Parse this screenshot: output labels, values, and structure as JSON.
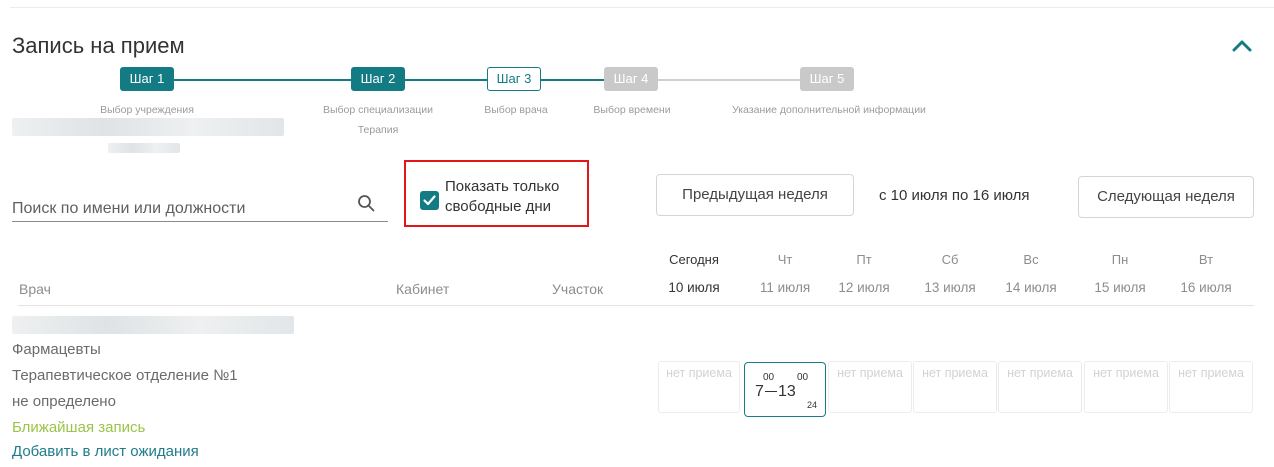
{
  "page_title": "Запись на прием",
  "stepper": {
    "steps": [
      {
        "label": "Шаг 1",
        "caption": "Выбор учреждения",
        "state": "done"
      },
      {
        "label": "Шаг 2",
        "caption": "Выбор специализации",
        "sub": "Терапия",
        "state": "done"
      },
      {
        "label": "Шаг 3",
        "caption": "Выбор врача",
        "state": "current"
      },
      {
        "label": "Шаг 4",
        "caption": "Выбор времени",
        "state": "todo"
      },
      {
        "label": "Шаг 5",
        "caption": "Указание дополнительной информации",
        "state": "todo"
      }
    ]
  },
  "search": {
    "placeholder": "Поиск по имени или должности",
    "value": ""
  },
  "filter": {
    "label_line1": "Показать только",
    "label_line2": "свободные дни",
    "checked": true
  },
  "week_nav": {
    "prev_label": "Предыдущая неделя",
    "range_label": "с 10 июля по 16 июля",
    "next_label": "Следующая неделя"
  },
  "table": {
    "col_doctor": "Врач",
    "col_room": "Кабинет",
    "col_area": "Участок",
    "days": [
      {
        "name": "Сегодня",
        "date": "10 июля",
        "today": true
      },
      {
        "name": "Чт",
        "date": "11 июля"
      },
      {
        "name": "Пт",
        "date": "12 июля"
      },
      {
        "name": "Сб",
        "date": "13 июля"
      },
      {
        "name": "Вс",
        "date": "14 июля"
      },
      {
        "name": "Пн",
        "date": "15 июля"
      },
      {
        "name": "Вт",
        "date": "16 июля"
      }
    ]
  },
  "doctor": {
    "position": "Фармацевты",
    "department": "Терапевтическое отделение №1",
    "area": "не определено",
    "nearest_link": "Ближайшая запись",
    "waitlist_link": "Добавить в лист ожидания"
  },
  "schedule": {
    "no_reception": "нет приема",
    "slot": {
      "start_hour": "7",
      "start_min": "00",
      "end_hour": "13",
      "end_min": "00",
      "count": "24"
    }
  },
  "colors": {
    "accent": "#137b84",
    "disabled": "#c9c9c9",
    "highlight": "#e0161b",
    "link_green": "#9cc34a",
    "link_teal": "#1f7d8a"
  },
  "icons": {
    "collapse": "chevron-up-icon",
    "search": "search-icon",
    "checkbox": "checkmark-icon"
  }
}
